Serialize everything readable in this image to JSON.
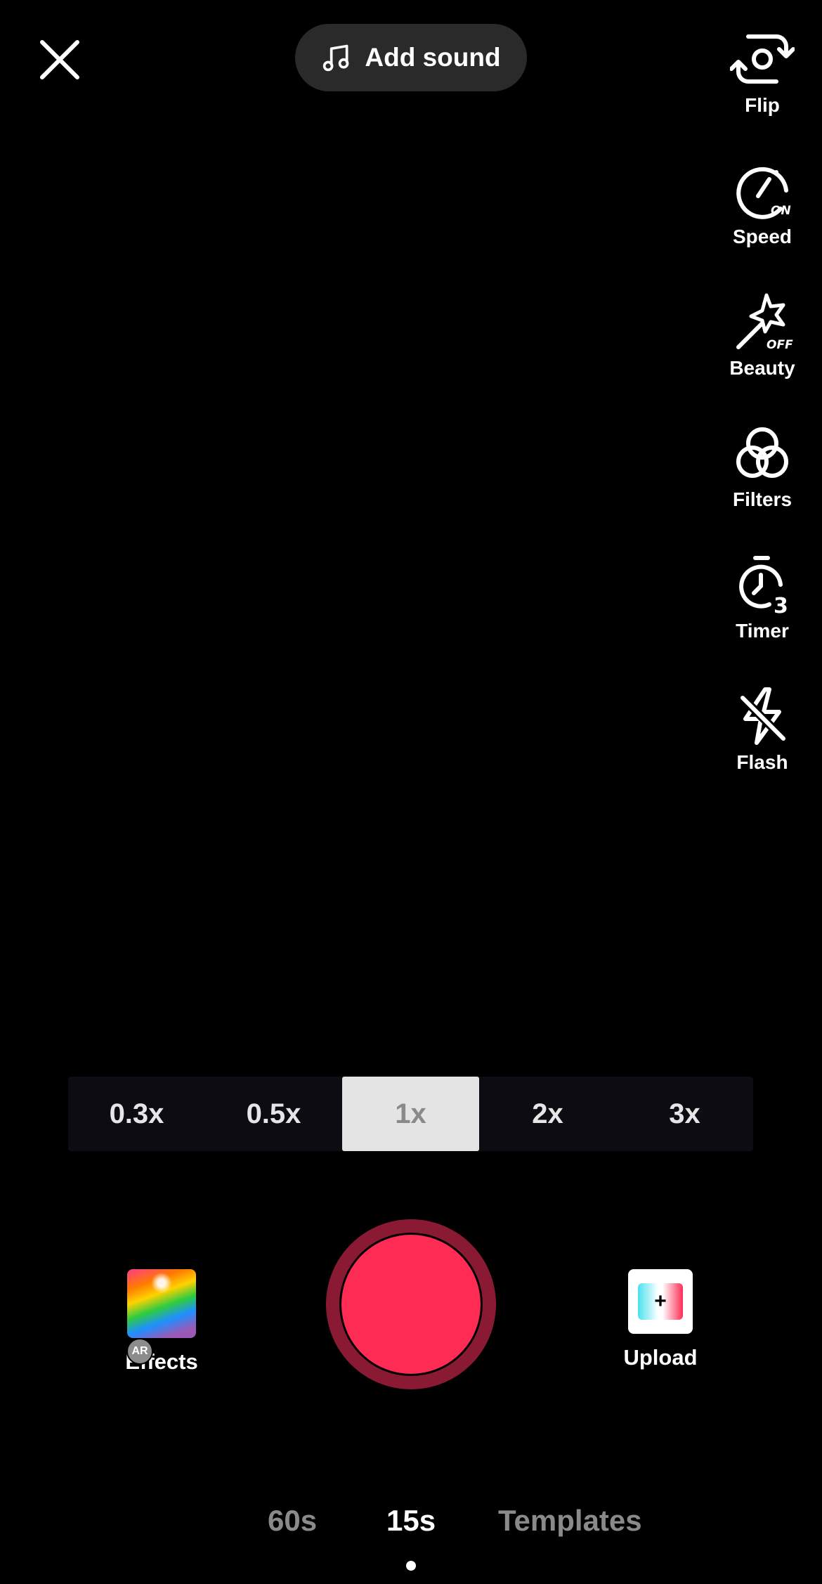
{
  "header": {
    "add_sound_label": "Add sound"
  },
  "side_tools": [
    {
      "label": "Flip",
      "icon": "flip-camera-icon"
    },
    {
      "label": "Speed",
      "icon": "speed-gauge-icon",
      "badge": "ON"
    },
    {
      "label": "Beauty",
      "icon": "magic-wand-icon",
      "badge": "OFF"
    },
    {
      "label": "Filters",
      "icon": "filters-circles-icon"
    },
    {
      "label": "Timer",
      "icon": "timer-icon",
      "badge": "3"
    },
    {
      "label": "Flash",
      "icon": "flash-off-icon"
    }
  ],
  "speed": {
    "options": [
      "0.3x",
      "0.5x",
      "1x",
      "2x",
      "3x"
    ],
    "selected": "1x"
  },
  "bottom": {
    "effects_label": "Effects",
    "ar_badge": "AR",
    "upload_label": "Upload",
    "upload_plus": "+"
  },
  "modes": {
    "items": [
      "60s",
      "15s",
      "Templates"
    ],
    "selected": "15s"
  },
  "colors": {
    "record": "#fe2c55",
    "record_ring": "#8a1a34",
    "background": "#000000"
  }
}
